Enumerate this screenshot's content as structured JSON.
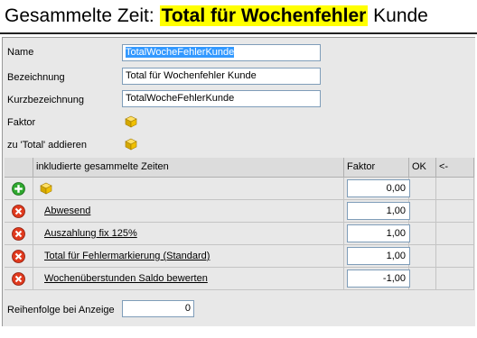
{
  "title": {
    "prefix": "Gesammelte Zeit: ",
    "highlight": "Total für Wochenfehler",
    "suffix": " Kunde"
  },
  "form": {
    "name_label": "Name",
    "name_value": "TotalWocheFehlerKunde",
    "bezeichnung_label": "Bezeichnung",
    "bezeichnung_value": "Total für Wochenfehler Kunde",
    "kurz_label": "Kurzbezeichnung",
    "kurz_value": "TotalWocheFehlerKunde",
    "faktor_label": "Faktor",
    "total_label": "zu 'Total' addieren"
  },
  "grid": {
    "headers": [
      "inkludierte gesammelte Zeiten",
      "Faktor",
      "OK",
      "<-"
    ],
    "new_row_factor": "0,00",
    "rows": [
      {
        "name": "Abwesend",
        "factor": "1,00"
      },
      {
        "name": "Auszahlung fix 125%",
        "factor": "1,00"
      },
      {
        "name": "Total für Fehlermarkierung (Standard)",
        "factor": "1,00"
      },
      {
        "name": "Wochenüberstunden Saldo bewerten",
        "factor": "-1,00"
      }
    ]
  },
  "footer": {
    "label": "Reihenfolge bei Anzeige",
    "value": "0"
  },
  "colors": {
    "highlight": "#ffff00",
    "selection": "#3399ff",
    "panel": "#e8e8e8"
  },
  "icons": {
    "cube": "cube-icon",
    "add": "add-icon",
    "delete": "delete-icon"
  }
}
